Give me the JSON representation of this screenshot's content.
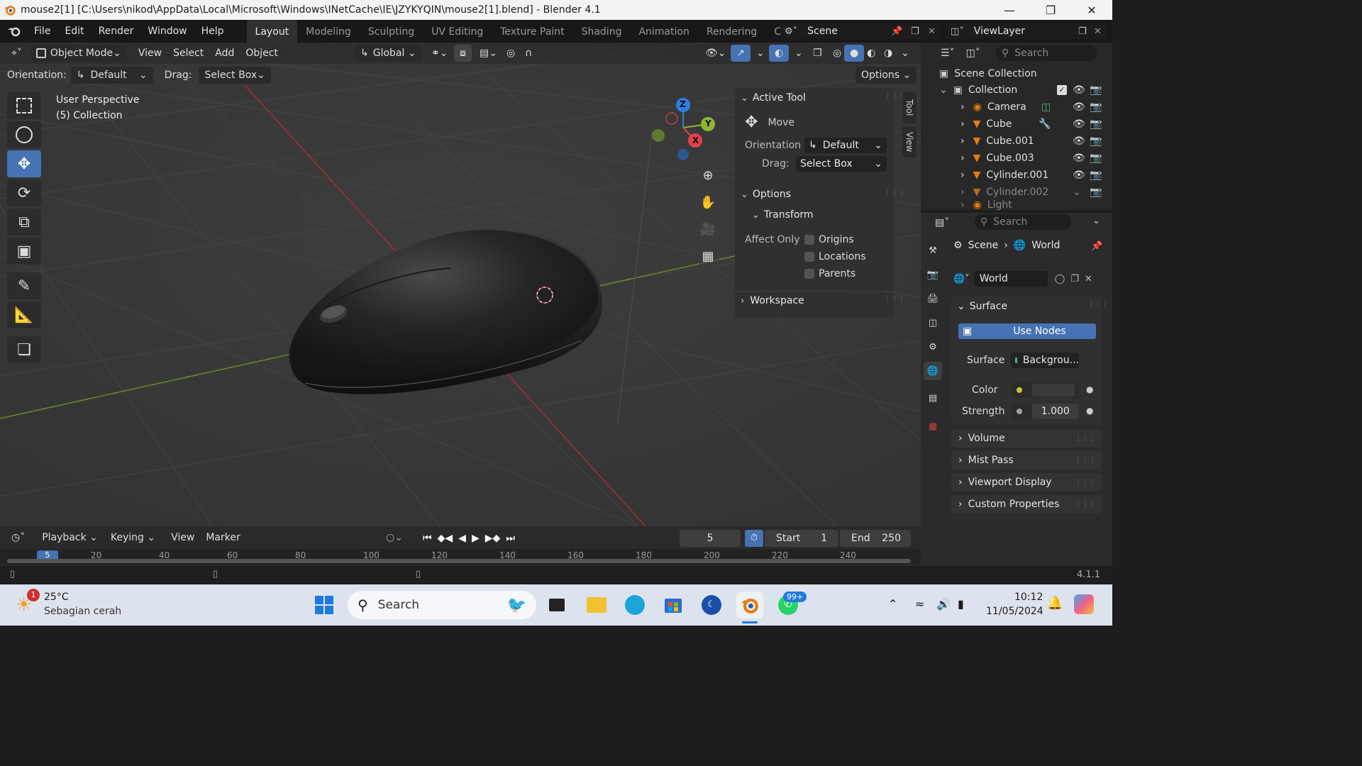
{
  "window": {
    "title": "mouse2[1] [C:\\Users\\nikod\\AppData\\Local\\Microsoft\\Windows\\INetCache\\IE\\JZYKYQIN\\mouse2[1].blend] - Blender 4.1"
  },
  "menus": [
    "File",
    "Edit",
    "Render",
    "Window",
    "Help"
  ],
  "workspaces": [
    "Layout",
    "Modeling",
    "Sculpting",
    "UV Editing",
    "Texture Paint",
    "Shading",
    "Animation",
    "Rendering",
    "Compositin"
  ],
  "active_workspace": "Layout",
  "scene": {
    "name": "Scene",
    "viewlayer": "ViewLayer"
  },
  "vp_header": {
    "mode": "Object Mode",
    "menus": [
      "View",
      "Select",
      "Add",
      "Object"
    ],
    "transform": "Global"
  },
  "tool_settings": {
    "orientation_label": "Orientation:",
    "orientation": "Default",
    "drag_label": "Drag:",
    "drag": "Select Box",
    "options": "Options"
  },
  "overlay_text": {
    "perspective": "User Perspective",
    "collection": "(5) Collection"
  },
  "npanel": {
    "active_tool": "Active Tool",
    "tool_name": "Move",
    "orientation_label": "Orientation",
    "orientation": "Default",
    "drag_label": "Drag:",
    "drag": "Select Box",
    "options": "Options",
    "transform": "Transform",
    "affect_only": "Affect Only",
    "origins": "Origins",
    "locations": "Locations",
    "parents": "Parents",
    "workspace": "Workspace"
  },
  "side_tabs": {
    "tool": "Tool",
    "view": "View"
  },
  "gizmo": {
    "z": "Z",
    "y": "Y",
    "x": "X"
  },
  "outliner": {
    "search": "Search",
    "scene_collection": "Scene Collection",
    "collection": "Collection",
    "items": [
      "Camera",
      "Cube",
      "Cube.001",
      "Cube.003",
      "Cylinder.001",
      "Cylinder.002",
      "Light"
    ]
  },
  "properties": {
    "search": "Search",
    "bc_scene": "Scene",
    "bc_world": "World",
    "world_name": "World",
    "surface_section": "Surface",
    "use_nodes": "Use Nodes",
    "surface_label": "Surface",
    "surface_value": "Backgrou...",
    "color_label": "Color",
    "strength_label": "Strength",
    "strength_value": "1.000",
    "sections": [
      "Volume",
      "Mist Pass",
      "Viewport Display",
      "Custom Properties"
    ]
  },
  "timeline": {
    "menus": [
      "Playback",
      "Keying",
      "View",
      "Marker"
    ],
    "current_frame": "5",
    "start_label": "Start",
    "start": "1",
    "end_label": "End",
    "end": "250",
    "ticks": [
      "20",
      "40",
      "60",
      "80",
      "100",
      "120",
      "140",
      "160",
      "180",
      "200",
      "220",
      "240"
    ],
    "playhead": "5"
  },
  "status": {
    "version": "4.1.1"
  },
  "taskbar": {
    "weather_temp": "25°C",
    "weather_desc": "Sebagian cerah",
    "weather_badge": "1",
    "search": "Search",
    "whatsapp_badge": "99+",
    "time": "10:12",
    "date": "11/05/2024"
  },
  "colors": {
    "accent": "#4772b3",
    "x_axis": "#e0424a",
    "y_axis": "#8fb632",
    "z_axis": "#2e7fe0",
    "blender_orange": "#e87d0d"
  }
}
